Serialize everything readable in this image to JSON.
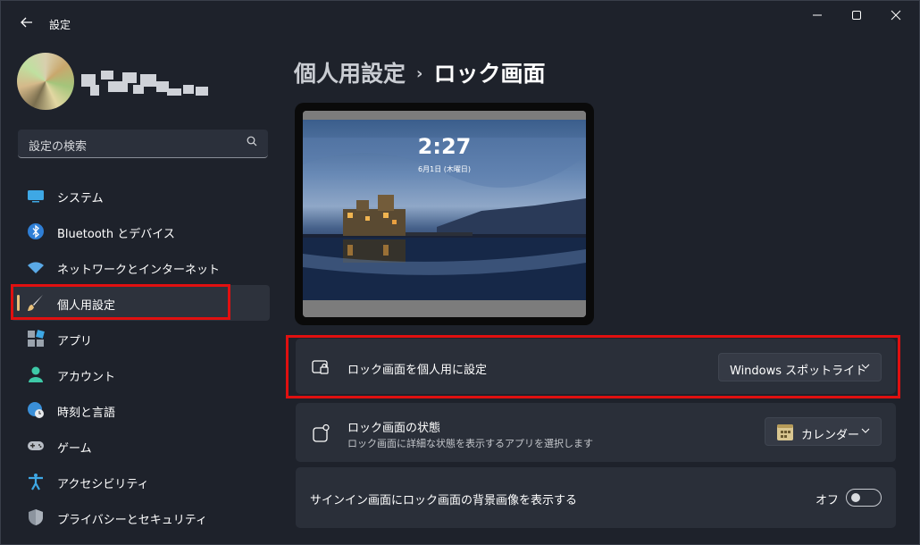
{
  "window": {
    "app_title": "設定",
    "back_icon": "back-arrow-icon",
    "controls": [
      "minimize-icon",
      "maximize-icon",
      "close-icon"
    ]
  },
  "search": {
    "placeholder": "設定の検索",
    "icon": "search-icon"
  },
  "sidebar": {
    "items": [
      {
        "label": "システム",
        "icon": "system-monitor-icon"
      },
      {
        "label": "Bluetooth とデバイス",
        "icon": "bluetooth-icon"
      },
      {
        "label": "ネットワークとインターネット",
        "icon": "wifi-icon"
      },
      {
        "label": "個人用設定",
        "icon": "paintbrush-icon",
        "selected": true
      },
      {
        "label": "アプリ",
        "icon": "apps-icon"
      },
      {
        "label": "アカウント",
        "icon": "person-icon"
      },
      {
        "label": "時刻と言語",
        "icon": "globe-clock-icon"
      },
      {
        "label": "ゲーム",
        "icon": "gamepad-icon"
      },
      {
        "label": "アクセシビリティ",
        "icon": "accessibility-icon"
      },
      {
        "label": "プライバシーとセキュリティ",
        "icon": "shield-icon"
      }
    ]
  },
  "breadcrumb": {
    "parent": "個人用設定",
    "separator": "›",
    "current": "ロック画面"
  },
  "preview": {
    "time": "2:27",
    "date": "6月1日 (木曜日)"
  },
  "settings": {
    "personalize": {
      "title": "ロック画面を個人用に設定",
      "value": "Windows スポットライト",
      "icon": "lock-screen-icon"
    },
    "status": {
      "title": "ロック画面の状態",
      "subtitle": "ロック画面に詳細な状態を表示するアプリを選択します",
      "value": "カレンダー",
      "icon": "status-notification-icon",
      "value_icon": "calendar-icon"
    },
    "signin_bg": {
      "title": "サインイン画面にロック画面の背景画像を表示する",
      "toggle_label": "オフ",
      "toggle_on": false
    }
  },
  "colors": {
    "highlight_border": "#e01010",
    "accent": "#e8c07a",
    "card": "#2a2f39",
    "background": "#1e222b"
  }
}
